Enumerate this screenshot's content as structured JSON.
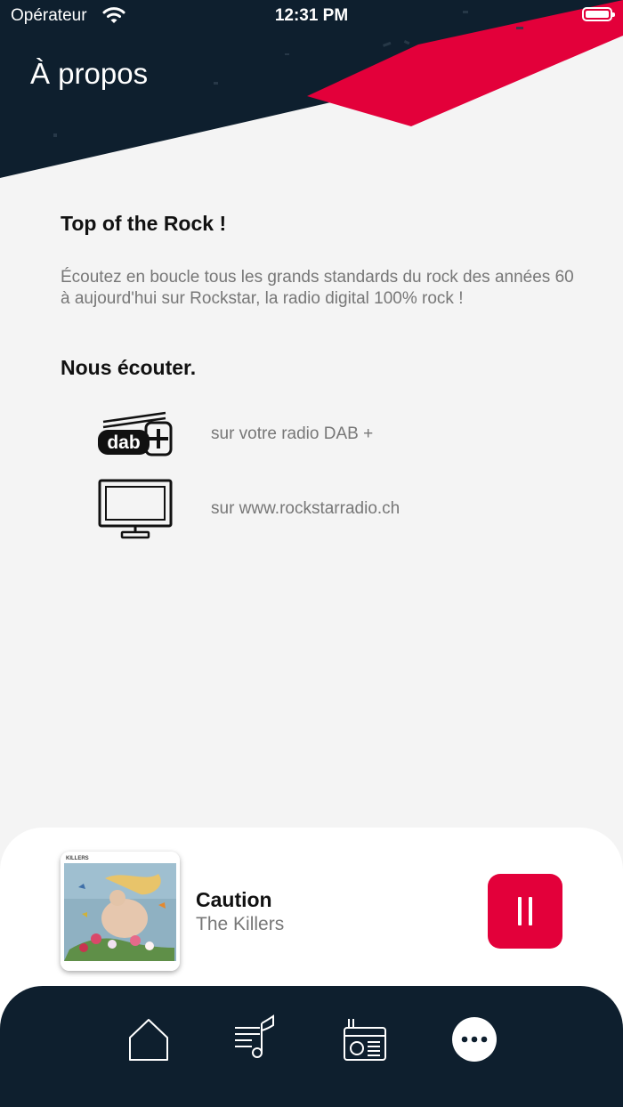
{
  "status_bar": {
    "carrier": "Opérateur",
    "time": "12:31 PM"
  },
  "header": {
    "title": "À propos"
  },
  "about": {
    "heading": "Top of the Rock !",
    "description": "Écoutez en boucle tous les grands standards du rock des années 60 à aujourd'hui sur Rockstar, la radio digital 100% rock !"
  },
  "listen": {
    "heading": "Nous écouter.",
    "items": [
      {
        "icon": "dab-radio-icon",
        "label": "sur votre radio DAB +",
        "icon_text": "dab"
      },
      {
        "icon": "tv-icon",
        "label": "sur www.rockstarradio.ch"
      }
    ]
  },
  "player": {
    "title": "Caution",
    "artist": "The Killers",
    "cover_label": "KILLERS",
    "state": "playing"
  },
  "tabs": [
    {
      "icon": "home-icon"
    },
    {
      "icon": "music-list-icon"
    },
    {
      "icon": "radio-icon"
    },
    {
      "icon": "more-icon",
      "active": true
    }
  ],
  "colors": {
    "navy": "#0e1f2e",
    "accent_red": "#e3003a",
    "background": "#f4f4f4"
  }
}
